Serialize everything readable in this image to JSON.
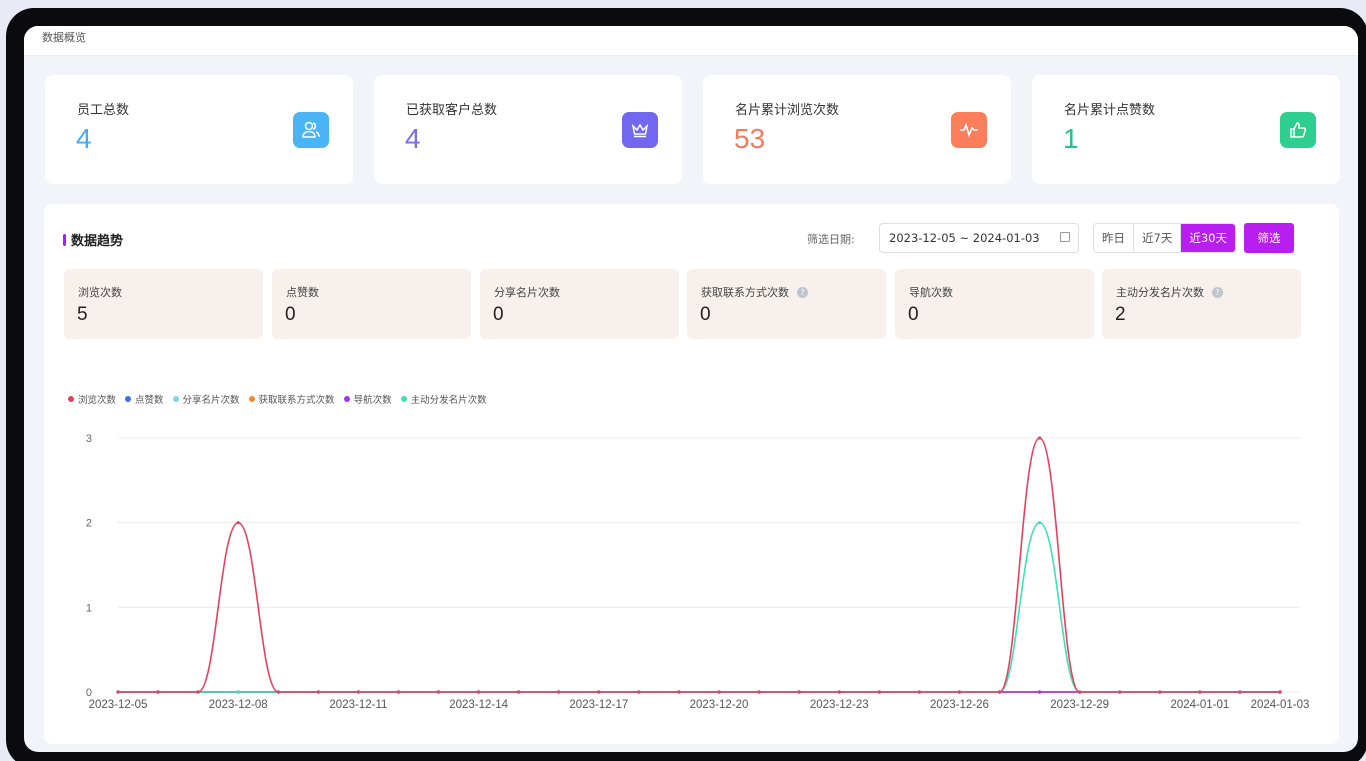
{
  "breadcrumb": "数据概览",
  "cards": [
    {
      "title": "员工总数",
      "value": "4",
      "color": "#4aa8f0",
      "icon_bg": "#4ab4f5",
      "icon": "users-icon"
    },
    {
      "title": "已获取客户总数",
      "value": "4",
      "color": "#7b6ce8",
      "icon_bg": "#7367f0",
      "icon": "crown-icon"
    },
    {
      "title": "名片累计浏览次数",
      "value": "53",
      "color": "#f47b5a",
      "icon_bg": "#fb7e5a",
      "icon": "pulse-icon"
    },
    {
      "title": "名片累计点赞数",
      "value": "1",
      "color": "#22c48a",
      "icon_bg": "#2ccf8f",
      "icon": "thumbs-up-icon"
    }
  ],
  "trend": {
    "title": "数据趋势",
    "filter_label": "筛选日期:",
    "date_range": "2023-12-05 ~ 2024-01-03",
    "range_options": [
      "昨日",
      "近7天",
      "近30天"
    ],
    "filter_button": "筛选"
  },
  "stats": [
    {
      "label": "浏览次数",
      "value": "5",
      "help": false
    },
    {
      "label": "点赞数",
      "value": "0",
      "help": false
    },
    {
      "label": "分享名片次数",
      "value": "0",
      "help": false
    },
    {
      "label": "获取联系方式次数",
      "value": "0",
      "help": true
    },
    {
      "label": "导航次数",
      "value": "0",
      "help": false
    },
    {
      "label": "主动分发名片次数",
      "value": "2",
      "help": true
    }
  ],
  "chart_data": {
    "type": "line",
    "x": [
      "2023-12-05",
      "2023-12-06",
      "2023-12-07",
      "2023-12-08",
      "2023-12-09",
      "2023-12-10",
      "2023-12-11",
      "2023-12-12",
      "2023-12-13",
      "2023-12-14",
      "2023-12-15",
      "2023-12-16",
      "2023-12-17",
      "2023-12-18",
      "2023-12-19",
      "2023-12-20",
      "2023-12-21",
      "2023-12-22",
      "2023-12-23",
      "2023-12-24",
      "2023-12-25",
      "2023-12-26",
      "2023-12-27",
      "2023-12-28",
      "2023-12-29",
      "2023-12-30",
      "2023-12-31",
      "2024-01-01",
      "2024-01-02",
      "2024-01-03"
    ],
    "x_tick_labels": [
      "2023-12-05",
      "2023-12-08",
      "2023-12-11",
      "2023-12-14",
      "2023-12-17",
      "2023-12-20",
      "2023-12-23",
      "2023-12-26",
      "2023-12-29",
      "2024-01-01",
      "2024-01-03"
    ],
    "y_ticks": [
      "0",
      "1",
      "2",
      "3"
    ],
    "ylim": [
      0,
      3
    ],
    "legend_position": "top-left",
    "grid": true,
    "series": [
      {
        "name": "浏览次数",
        "color": "#e8405c",
        "values": [
          0,
          0,
          0,
          2,
          0,
          0,
          0,
          0,
          0,
          0,
          0,
          0,
          0,
          0,
          0,
          0,
          0,
          0,
          0,
          0,
          0,
          0,
          0,
          3,
          0,
          0,
          0,
          0,
          0,
          0
        ]
      },
      {
        "name": "点赞数",
        "color": "#3d6fe6",
        "values": [
          0,
          0,
          0,
          0,
          0,
          0,
          0,
          0,
          0,
          0,
          0,
          0,
          0,
          0,
          0,
          0,
          0,
          0,
          0,
          0,
          0,
          0,
          0,
          0,
          0,
          0,
          0,
          0,
          0,
          0
        ]
      },
      {
        "name": "分享名片次数",
        "color": "#7fd3f0",
        "values": [
          0,
          0,
          0,
          0,
          0,
          0,
          0,
          0,
          0,
          0,
          0,
          0,
          0,
          0,
          0,
          0,
          0,
          0,
          0,
          0,
          0,
          0,
          0,
          0,
          0,
          0,
          0,
          0,
          0,
          0
        ]
      },
      {
        "name": "获取联系方式次数",
        "color": "#f58a2c",
        "values": [
          0,
          0,
          0,
          0,
          0,
          0,
          0,
          0,
          0,
          0,
          0,
          0,
          0,
          0,
          0,
          0,
          0,
          0,
          0,
          0,
          0,
          0,
          0,
          0,
          0,
          0,
          0,
          0,
          0,
          0
        ]
      },
      {
        "name": "导航次数",
        "color": "#a534e8",
        "values": [
          0,
          0,
          0,
          0,
          0,
          0,
          0,
          0,
          0,
          0,
          0,
          0,
          0,
          0,
          0,
          0,
          0,
          0,
          0,
          0,
          0,
          0,
          0,
          0,
          0,
          0,
          0,
          0,
          0,
          0
        ]
      },
      {
        "name": "主动分发名片次数",
        "color": "#3fe0b4",
        "values": [
          0,
          0,
          0,
          0,
          0,
          0,
          0,
          0,
          0,
          0,
          0,
          0,
          0,
          0,
          0,
          0,
          0,
          0,
          0,
          0,
          0,
          0,
          0,
          2,
          0,
          0,
          0,
          0,
          0,
          0
        ]
      }
    ]
  }
}
